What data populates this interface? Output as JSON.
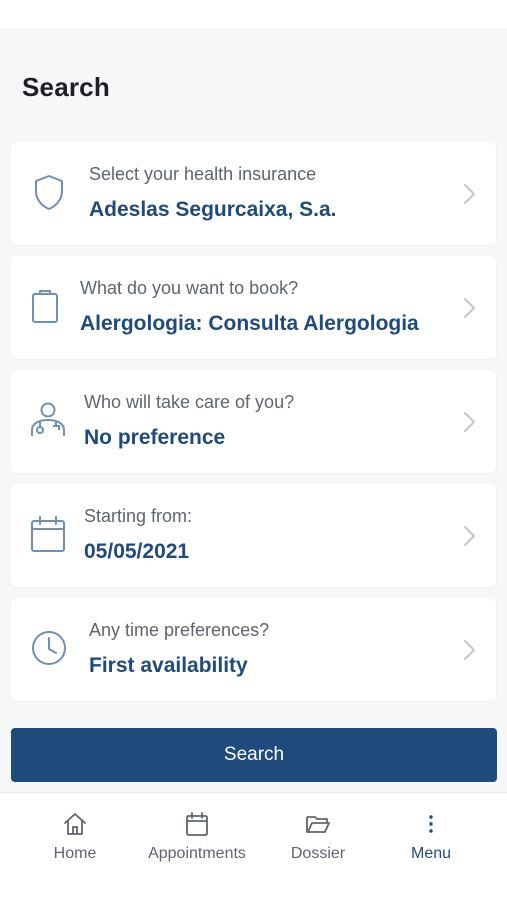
{
  "page": {
    "title": "Search"
  },
  "cards": [
    {
      "label": "Select your health insurance",
      "value": "Adeslas Segurcaixa, S.a.",
      "icon": "shield-icon"
    },
    {
      "label": "What do you want to book?",
      "value": "Alergologia: Consulta Alergologia",
      "icon": "clipboard-icon"
    },
    {
      "label": "Who will take care of you?",
      "value": "No preference",
      "icon": "doctor-icon"
    },
    {
      "label": "Starting from:",
      "value": "05/05/2021",
      "icon": "calendar-icon"
    },
    {
      "label": "Any time preferences?",
      "value": "First availability",
      "icon": "clock-icon"
    }
  ],
  "search_button": {
    "label": "Search"
  },
  "tabbar": {
    "items": [
      {
        "label": "Home",
        "icon": "home-icon"
      },
      {
        "label": "Appointments",
        "icon": "calendar-icon"
      },
      {
        "label": "Dossier",
        "icon": "folder-icon"
      },
      {
        "label": "Menu",
        "icon": "more-vertical-icon",
        "active": true
      }
    ]
  },
  "colors": {
    "accent": "#1f4a7c",
    "icon": "#6f8fb3",
    "background": "#f6f7f9",
    "label": "#5e6470"
  }
}
